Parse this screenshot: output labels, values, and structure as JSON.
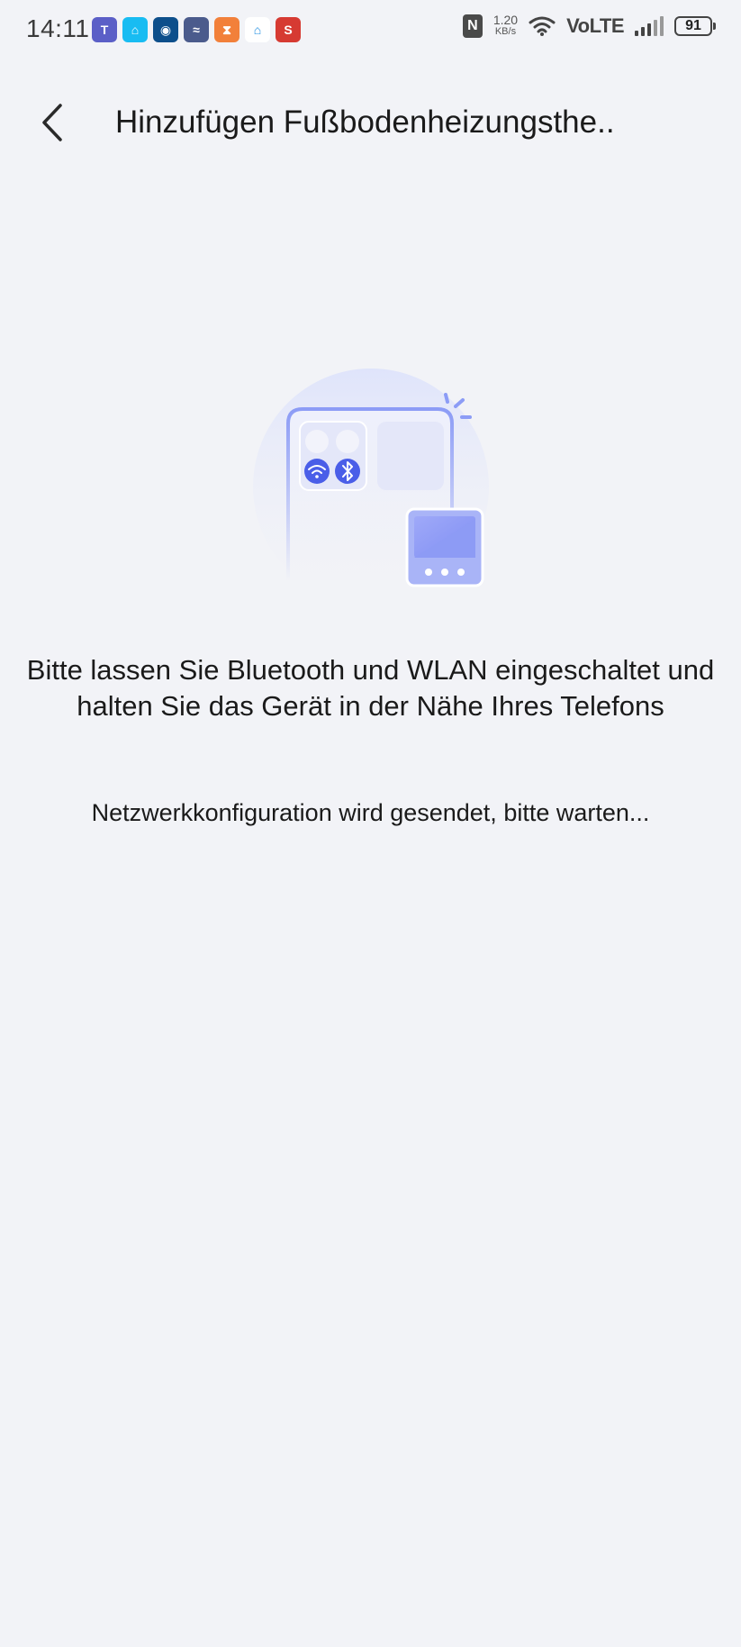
{
  "status_bar": {
    "time": "14:11",
    "app_icons": [
      {
        "name": "teams-icon",
        "color": "#5b5fc7",
        "glyph": "T"
      },
      {
        "name": "home-assistant-icon",
        "color": "#18bcf2",
        "glyph": "⌂"
      },
      {
        "name": "camera-app-icon",
        "color": "#0d4f8b",
        "glyph": "◉"
      },
      {
        "name": "aqara-icon",
        "color": "#4b5b8c",
        "glyph": "≈"
      },
      {
        "name": "hourglass-app-icon",
        "color": "#f2803a",
        "glyph": "⧗"
      },
      {
        "name": "smart-home-icon",
        "color": "#ffffff",
        "glyph": "⌂"
      },
      {
        "name": "s-app-icon",
        "color": "#d63a32",
        "glyph": "S"
      }
    ],
    "nfc_label": "N",
    "net_speed_value": "1.20",
    "net_speed_unit": "KB/s",
    "volte_label": "VoLTE",
    "battery_level": "91"
  },
  "header": {
    "back_icon": "chevron-left-icon",
    "title": "Hinzufügen Fußbodenheizungsthe.."
  },
  "main": {
    "instruction": "Bitte lassen Sie Bluetooth und WLAN eingeschaltet und halten Sie das Gerät in der Nähe Ihres Telefons",
    "status": "Netzwerkkonfiguration wird gesendet, bitte warten..."
  },
  "colors": {
    "background": "#f2f3f7",
    "accent": "#4a5ee8",
    "illustration_light": "#e3e7fb",
    "device_blue": "#8c9cf6"
  }
}
